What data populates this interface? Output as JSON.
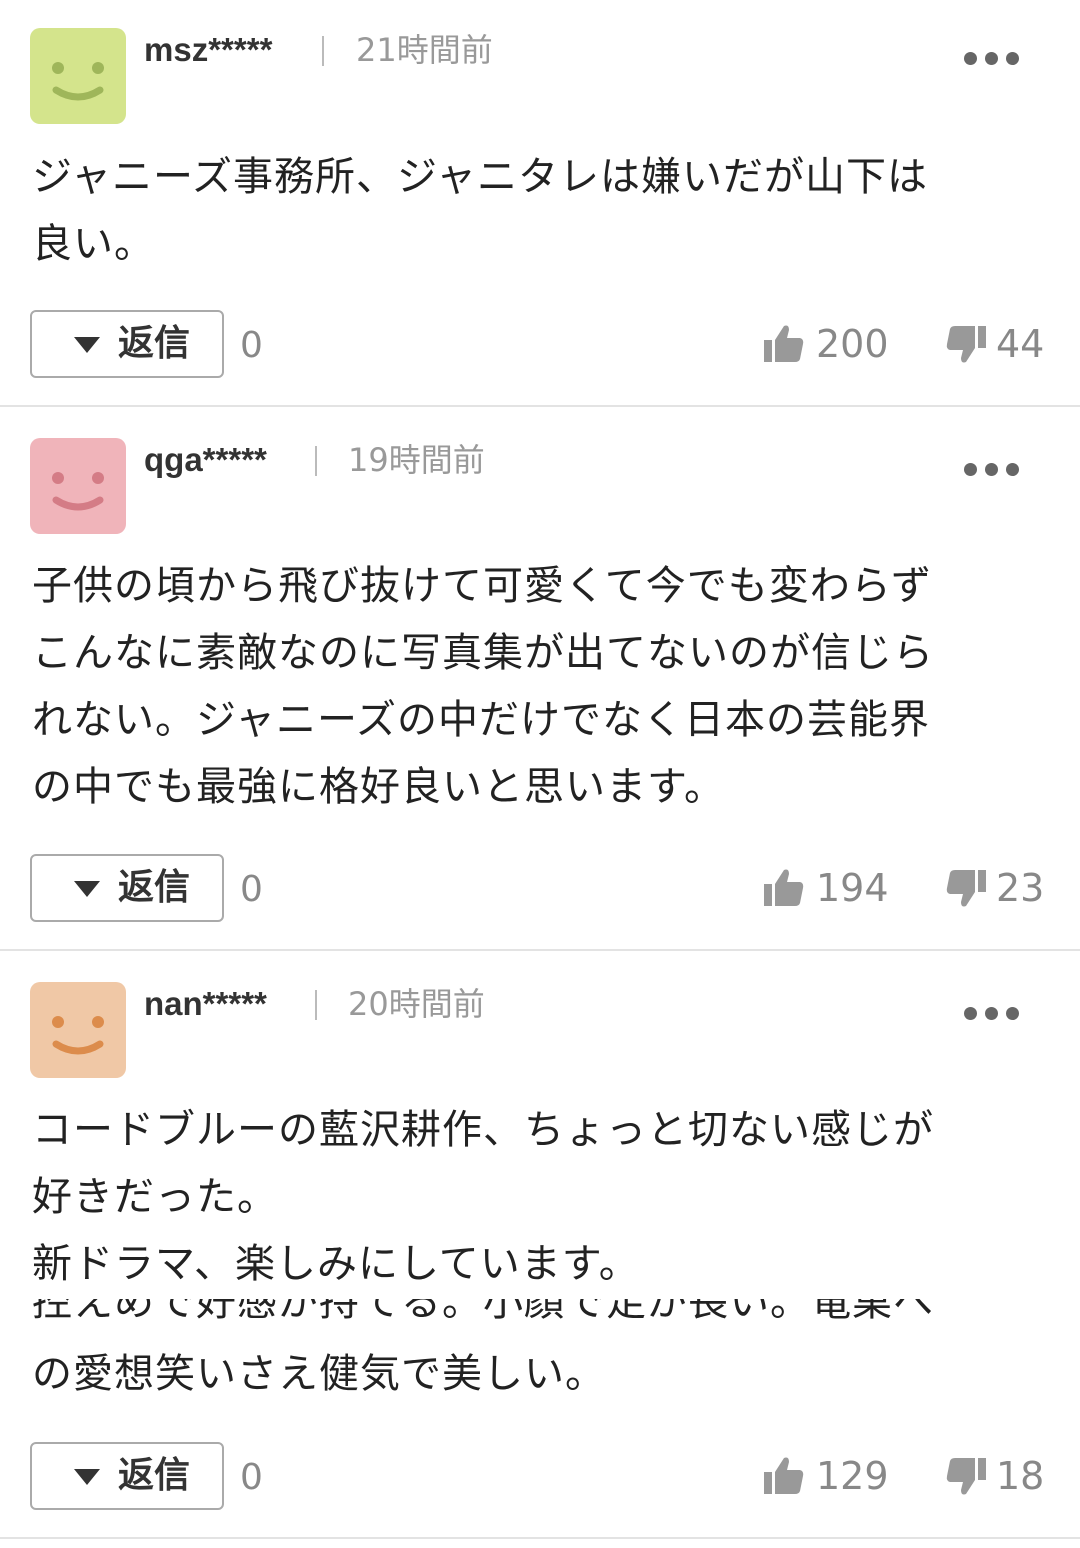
{
  "comments": [
    {
      "username": "msz*****",
      "time": "21時間前",
      "avatar_color": "#d4e48c",
      "avatar_face_color": "#9fb65a",
      "icon": "smiley-avatar-icon",
      "lines": [
        "ジャニーズ事務所、ジャニタレは嫌いだが山下は",
        "良い。"
      ],
      "reply_label": "返信",
      "reply_count": "0",
      "likes": "200",
      "dislikes": "44"
    },
    {
      "username": "qga*****",
      "time": "19時間前",
      "avatar_color": "#f0b4ba",
      "avatar_face_color": "#d47c86",
      "icon": "smiley-avatar-icon",
      "lines": [
        "子供の頃から飛び抜けて可愛くて今でも変わらず",
        "こんなに素敵なのに写真集が出てないのが信じら",
        "れない。ジャニーズの中だけでなく日本の芸能界",
        "の中でも最強に格好良いと思います。"
      ],
      "reply_label": "返信",
      "reply_count": "0",
      "likes": "194",
      "dislikes": "23"
    },
    {
      "username": "nan*****",
      "time": "20時間前",
      "avatar_color": "#f0c8a6",
      "avatar_face_color": "#dc8c4c",
      "icon": "smiley-avatar-icon",
      "lines": [
        "コードブルーの藍沢耕作、ちょっと切ない感じが",
        "好きだった。",
        "新ドラマ、楽しみにしています。"
      ],
      "overlap_line": "控えめで好感が持てる。小顔で足が長い。竜巣へ",
      "last_line": "の愛想笑いさえ健気で美しい。",
      "reply_label": "返信",
      "reply_count": "0",
      "likes": "129",
      "dislikes": "18"
    }
  ]
}
